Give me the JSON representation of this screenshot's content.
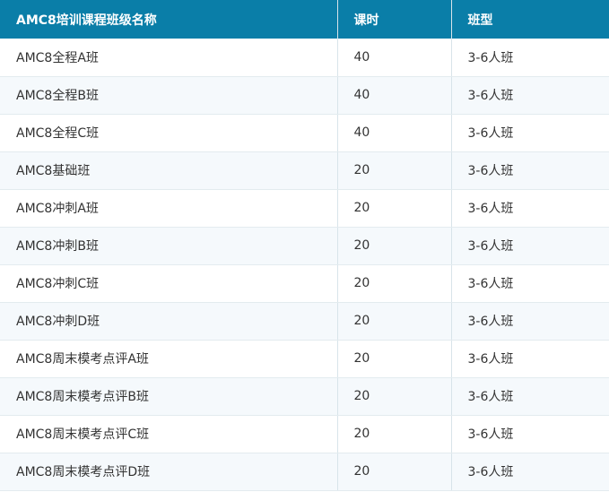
{
  "table": {
    "headers": [
      "AMC8培训课程班级名称",
      "课时",
      "班型"
    ],
    "rows": [
      [
        "AMC8全程A班",
        "40",
        "3-6人班"
      ],
      [
        "AMC8全程B班",
        "40",
        "3-6人班"
      ],
      [
        "AMC8全程C班",
        "40",
        "3-6人班"
      ],
      [
        "AMC8基础班",
        "20",
        "3-6人班"
      ],
      [
        "AMC8冲刺A班",
        "20",
        "3-6人班"
      ],
      [
        "AMC8冲刺B班",
        "20",
        "3-6人班"
      ],
      [
        "AMC8冲刺C班",
        "20",
        "3-6人班"
      ],
      [
        "AMC8冲刺D班",
        "20",
        "3-6人班"
      ],
      [
        "AMC8周末模考点评A班",
        "20",
        "3-6人班"
      ],
      [
        "AMC8周末模考点评B班",
        "20",
        "3-6人班"
      ],
      [
        "AMC8周末模考点评C班",
        "20",
        "3-6人班"
      ],
      [
        "AMC8周末模考点评D班",
        "20",
        "3-6人班"
      ]
    ]
  },
  "colors": {
    "header_bg": "#0a7ea8",
    "header_text": "#ffffff",
    "row_alt_bg": "#f5f9fc",
    "text": "#333333"
  }
}
